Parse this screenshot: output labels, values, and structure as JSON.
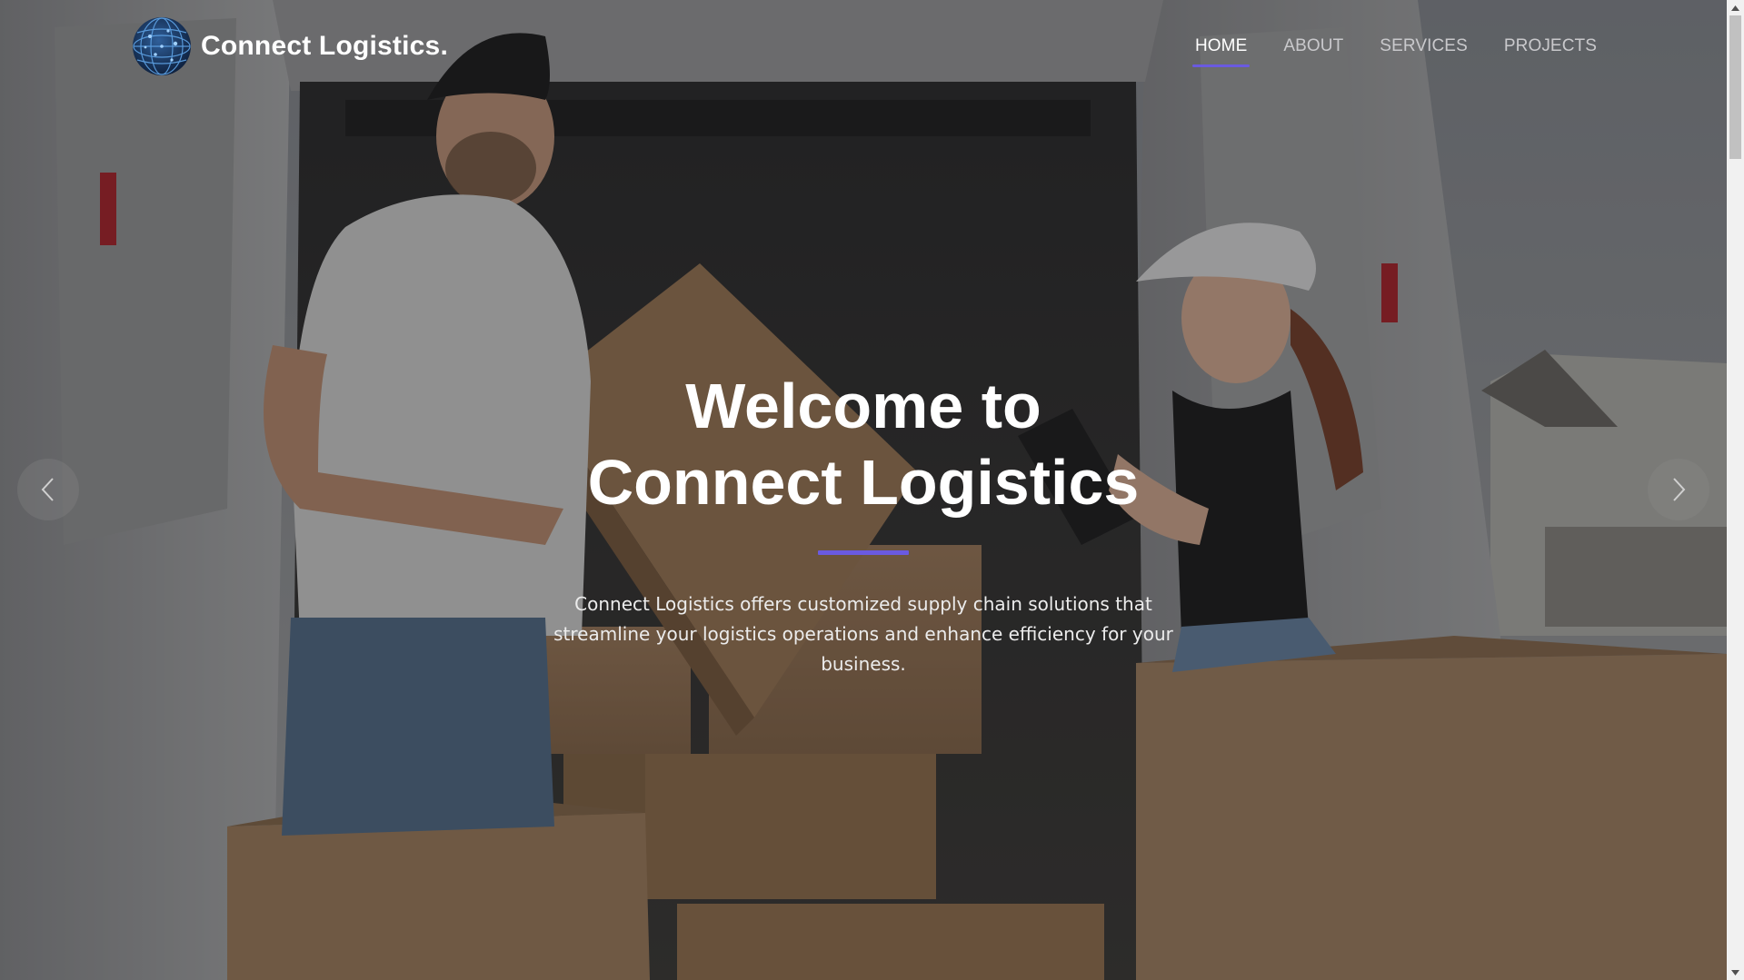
{
  "brand": {
    "name": "Connect Logistics",
    "dot": ".",
    "logo_icon": "globe-icon"
  },
  "nav": {
    "items": [
      {
        "label": "HOME",
        "active": true
      },
      {
        "label": "ABOUT",
        "active": false
      },
      {
        "label": "SERVICES",
        "active": false
      },
      {
        "label": "PROJECTS",
        "active": false
      }
    ]
  },
  "hero": {
    "title_line1": "Welcome to",
    "title_line2": "Connect Logistics",
    "description": "Connect Logistics offers customized supply chain solutions that streamline your logistics operations and enhance efficiency for your business.",
    "prev_icon": "chevron-left-icon",
    "next_icon": "chevron-right-icon"
  },
  "colors": {
    "accent": "#6a5ae0",
    "text": "#ffffff"
  }
}
